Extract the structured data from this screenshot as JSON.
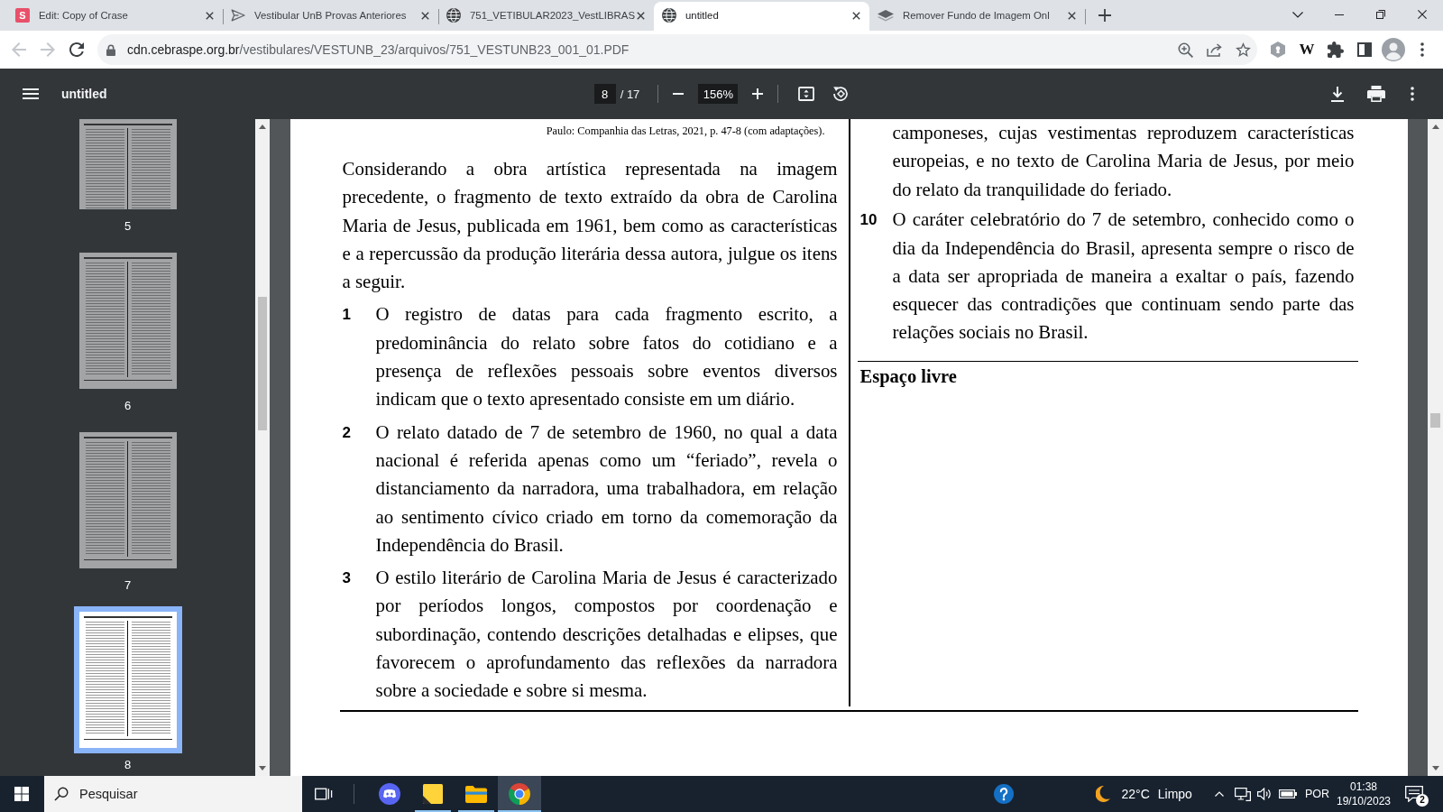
{
  "browser": {
    "tabs": [
      {
        "title": "Edit: Copy of Crase",
        "favicon_letter": "S",
        "selected": false
      },
      {
        "title": "Vestibular UnB Provas Anteriores",
        "selected": false
      },
      {
        "title": "751_VETIBULAR2023_VestLIBRAS",
        "selected": false
      },
      {
        "title": "untitled",
        "selected": true
      },
      {
        "title": "Remover Fundo de Imagem Onl",
        "selected": false
      }
    ],
    "back_disabled": true,
    "forward_disabled": true,
    "url": "cdn.cebraspe.org.br/vestibulares/VESTUNB_23/arquivos/751_VESTUNB23_001_01.PDF",
    "extension_letter": "W"
  },
  "pdf_toolbar": {
    "title": "untitled",
    "page": "8",
    "page_total": "/ 17",
    "zoom": "156%"
  },
  "sidebar": {
    "thumbnails": [
      {
        "label": "5",
        "selected": false
      },
      {
        "label": "6",
        "selected": false
      },
      {
        "label": "7",
        "selected": false
      },
      {
        "label": "8",
        "selected": true
      }
    ]
  },
  "document": {
    "left_column": {
      "citation": "Paulo: Companhia das Letras, 2021, p. 47-8 (com adaptações).",
      "intro": "Considerando a obra artística representada na imagem precedente, o fragmento de texto extraído da obra de Carolina Maria de Jesus, publicada em 1961, bem como as características e a repercussão da produção literária dessa autora, julgue os itens a seguir.",
      "items": [
        {
          "number": "1",
          "text": "O registro de datas para cada fragmento escrito, a predominância do relato sobre fatos do cotidiano e a presença de reflexões pessoais sobre eventos diversos indicam que o texto apresentado consiste em um diário."
        },
        {
          "number": "2",
          "text": "O relato datado de 7 de setembro de 1960, no qual a data nacional é referida apenas como um “feriado”, revela o distanciamento da narradora, uma trabalhadora, em relação ao sentimento cívico criado em torno da comemoração da Independência do Brasil."
        },
        {
          "number": "3",
          "text": "O estilo literário de Carolina Maria de Jesus é caracterizado por períodos longos, compostos por coordenação e subordinação, contendo descrições detalhadas e elipses, que favorecem o aprofundamento das reflexões da narradora sobre a sociedade e sobre si mesma."
        }
      ]
    },
    "right_column": {
      "continuation": "camponeses, cujas vestimentas reproduzem características europeias, e no texto de Carolina Maria de Jesus, por meio do relato da tranquilidade do feriado.",
      "items": [
        {
          "number": "10",
          "text": "O caráter celebratório do 7 de setembro, conhecido como o dia da Independência do Brasil, apresenta sempre o risco de a data ser apropriada de maneira a exaltar o país, fazendo esquecer das contradições que continuam sendo parte das relações sociais no Brasil."
        }
      ],
      "free_space_label": "Espaço livre"
    }
  },
  "taskbar": {
    "search_placeholder": "Pesquisar",
    "apps": [
      {
        "open": false,
        "focused": false
      },
      {
        "open": true,
        "focused": false
      },
      {
        "open": true,
        "focused": false
      },
      {
        "open": true,
        "focused": true
      }
    ],
    "temperature": "22°C",
    "condition": "Limpo",
    "language": "POR",
    "time": "01:38",
    "date": "19/10/2023",
    "notification_count": "2"
  }
}
